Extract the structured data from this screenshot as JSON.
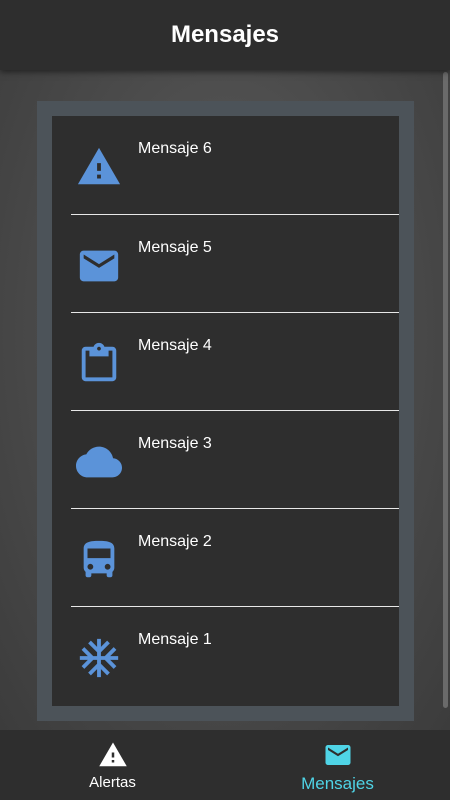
{
  "app_bar": {
    "title": "Mensajes"
  },
  "colors": {
    "icon_blue": "#5b93d9",
    "accent_cyan": "#4fd4e6"
  },
  "messages": [
    {
      "label": "Mensaje 6",
      "icon": "warning-icon"
    },
    {
      "label": "Mensaje 5",
      "icon": "mail-icon"
    },
    {
      "label": "Mensaje 4",
      "icon": "clipboard-icon"
    },
    {
      "label": "Mensaje 3",
      "icon": "cloud-icon"
    },
    {
      "label": "Mensaje 2",
      "icon": "bus-icon"
    },
    {
      "label": "Mensaje 1",
      "icon": "snowflake-icon"
    }
  ],
  "bottom_nav": {
    "tabs": [
      {
        "label": "Alertas",
        "icon": "warning-icon",
        "active": false
      },
      {
        "label": "Mensajes",
        "icon": "mail-icon",
        "active": true
      }
    ]
  }
}
